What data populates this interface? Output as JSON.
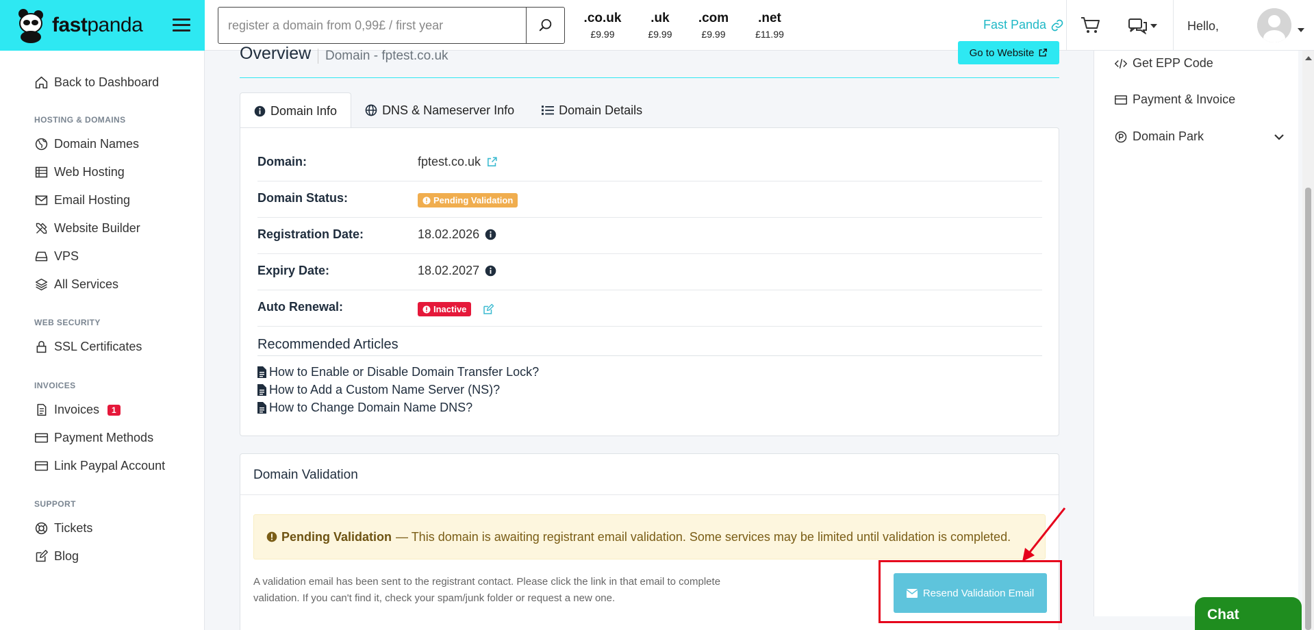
{
  "brand": {
    "name_bold": "fast",
    "name_light": "panda"
  },
  "search": {
    "placeholder": "register a domain from 0,99£ / first year",
    "value": ""
  },
  "tlds": [
    {
      "ext": ".co.uk",
      "price": "£9.99"
    },
    {
      "ext": ".uk",
      "price": "£9.99"
    },
    {
      "ext": ".com",
      "price": "£9.99"
    },
    {
      "ext": ".net",
      "price": "£11.99"
    }
  ],
  "header": {
    "fast_panda_link": "Fast Panda",
    "greeting": "Hello,"
  },
  "sidebar": {
    "back": "Back to Dashboard",
    "sections": {
      "hosting": "HOSTING & DOMAINS",
      "security": "WEB SECURITY",
      "invoices": "INVOICES",
      "support": "SUPPORT"
    },
    "items": {
      "domain_names": "Domain Names",
      "web_hosting": "Web Hosting",
      "email_hosting": "Email Hosting",
      "website_builder": "Website Builder",
      "vps": "VPS",
      "all_services": "All Services",
      "ssl": "SSL Certificates",
      "invoices": "Invoices",
      "invoices_badge": "1",
      "payment_methods": "Payment Methods",
      "link_paypal": "Link Paypal Account",
      "tickets": "Tickets",
      "blog": "Blog"
    }
  },
  "page": {
    "title": "Overview",
    "subtitle": "Domain - fptest.co.uk",
    "goto_button": "Go to Website"
  },
  "tabs": [
    {
      "label": "Domain Info",
      "active": true
    },
    {
      "label": "DNS & Nameserver Info",
      "active": false
    },
    {
      "label": "Domain Details",
      "active": false
    }
  ],
  "domain_info": {
    "domain_label": "Domain:",
    "domain_value": "fptest.co.uk",
    "status_label": "Domain Status:",
    "status_value": "Pending Validation",
    "reg_label": "Registration Date:",
    "reg_value": "18.02.2026",
    "exp_label": "Expiry Date:",
    "exp_value": "18.02.2027",
    "renewal_label": "Auto Renewal:",
    "renewal_value": "Inactive"
  },
  "articles": {
    "title": "Recommended Articles",
    "items": [
      "How to Enable or Disable Domain Transfer Lock?",
      "How to Add a Custom Name Server (NS)?",
      "How to Change Domain Name DNS?"
    ]
  },
  "validation": {
    "title": "Domain Validation",
    "alert_bold": "Pending Validation",
    "alert_text": "— This domain is awaiting registrant email validation. Some services may be limited until validation is completed.",
    "info_text": "A validation email has been sent to the registrant contact. Please click the link in that email to complete validation. If you can't find it, check your spam/junk folder or request a new one.",
    "resend_button": "Resend Validation Email"
  },
  "right_panel": {
    "get_epp": "Get EPP Code",
    "payment_invoice": "Payment & Invoice",
    "domain_park": "Domain Park"
  },
  "chat": {
    "label": "Chat"
  },
  "colors": {
    "brand": "#2ee8f2",
    "accent_text": "#1fb8c6",
    "danger": "#e5183a",
    "warning": "#f0ad4e",
    "chat": "#1f8d1f"
  }
}
